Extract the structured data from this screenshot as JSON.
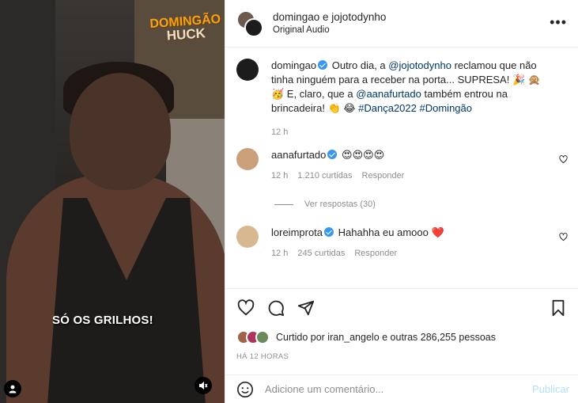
{
  "media": {
    "logo_top": "DOMINGÃO",
    "logo_bottom": "HUCK",
    "caption": "SÓ OS GRILHOS!",
    "user_icon": "user-icon",
    "mute_icon": "muted-speaker-icon"
  },
  "header": {
    "title": "domingao e jojotodynho",
    "subtitle": "Original Audio",
    "more_label": "•••"
  },
  "post": {
    "user": "domingao",
    "text_1": " Outro dia, a ",
    "mention_1": "@jojotodynho",
    "text_2": " reclamou que não tinha ninguém para a receber na porta... SUPRESA! 🎉 🙊 🥳 E, claro, que a ",
    "mention_2": "@aanafurtado",
    "text_3": " também entrou na brincadeira! 👏 😂 ",
    "hashtag_1": "#Dança2022",
    "hashtag_2": "#Domingão",
    "time": "12 h"
  },
  "comments": [
    {
      "user": "aanafurtado",
      "text": " 😍😍😍😍",
      "time": "12 h",
      "likes": "1.210 curtidas",
      "reply": "Responder",
      "view_replies": "Ver respostas (30)",
      "avatar_color": "#c9a07a"
    },
    {
      "user": "loreimprota",
      "text": " Hahahha eu amooo ❤️",
      "time": "12 h",
      "likes": "245 curtidas",
      "reply": "Responder",
      "avatar_color": "#d8b890"
    }
  ],
  "actions": {
    "like_icon": "heart-icon",
    "comment_icon": "comment-icon",
    "share_icon": "send-icon",
    "save_icon": "bookmark-icon",
    "liked_by": "Curtido por iran_angelo e outras 286,255 pessoas",
    "time": "HÁ 12 HORAS"
  },
  "add_comment": {
    "placeholder": "Adicione um comentário...",
    "post_label": "Publicar"
  }
}
